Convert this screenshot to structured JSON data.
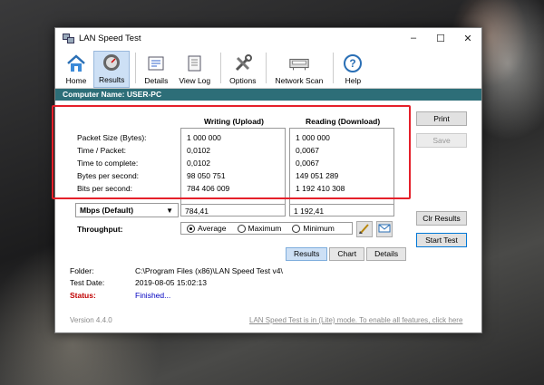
{
  "window": {
    "title": "LAN Speed Test",
    "min": "–",
    "max": "☐",
    "close": "✕"
  },
  "toolbar": [
    {
      "label": "Home",
      "icon": "home-icon"
    },
    {
      "label": "Results",
      "icon": "results-icon"
    },
    {
      "label": "Details",
      "icon": "details-icon"
    },
    {
      "label": "View Log",
      "icon": "log-icon"
    },
    {
      "label": "Options",
      "icon": "options-icon"
    },
    {
      "label": "Network Scan",
      "icon": "network-scan-icon"
    },
    {
      "label": "Help",
      "icon": "help-icon"
    }
  ],
  "computer_name": "Computer Name: USER-PC",
  "results": {
    "writing_header": "Writing (Upload)",
    "reading_header": "Reading (Download)",
    "rows": [
      "Packet Size (Bytes):",
      "Time / Packet:",
      "Time to complete:",
      "Bytes per second:",
      "Bits per second:"
    ],
    "writing": [
      "1 000 000",
      "0,0102",
      "0,0102",
      "98 050 751",
      "784 406 009"
    ],
    "reading": [
      "1 000 000",
      "0,0067",
      "0,0067",
      "149 051 289",
      "1 192 410 308"
    ]
  },
  "units_select": "Mbps (Default)",
  "write_mbps": "784,41",
  "read_mbps": "1 192,41",
  "throughput": {
    "label": "Throughput:",
    "options": [
      "Average",
      "Maximum",
      "Minimum"
    ],
    "selected": "Average"
  },
  "buttons": {
    "print": "Print",
    "save": "Save",
    "clr_results": "Clr Results",
    "start_test": "Start Test"
  },
  "tabs": [
    "Results",
    "Chart",
    "Details"
  ],
  "info": {
    "folder_label": "Folder:",
    "folder_value": "C:\\Program Files (x86)\\LAN Speed Test v4\\",
    "date_label": "Test Date:",
    "date_value": "2019-08-05 15:02:13",
    "status_label": "Status:",
    "status_value": "Finished..."
  },
  "footer": {
    "version": "Version 4.4.0",
    "lite_notice": "LAN Speed Test is in (Lite) mode.  To enable all features, click here"
  },
  "colors": {
    "accent": "#2d6e78",
    "highlight": "#e5202a",
    "status_label": "#c00000",
    "status_value": "#0000c0"
  }
}
